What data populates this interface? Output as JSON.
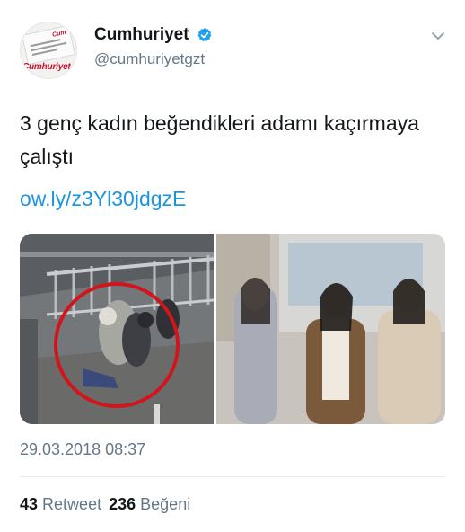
{
  "account": {
    "name": "Cumhuriyet",
    "handle": "@cumhuriyetgzt",
    "avatar_logo_text": "Cumhuriyet",
    "verified": true
  },
  "tweet": {
    "text": "3 genç kadın beğendikleri adamı kaçırmaya çalıştı",
    "link": "ow.ly/z3Yl30jdgzE",
    "timestamp": "29.03.2018 08:37"
  },
  "stats": {
    "retweets_count": "43",
    "retweets_label": "Retweet",
    "likes_count": "236",
    "likes_label": "Beğeni"
  },
  "icons": {
    "verified": "verified-badge-icon",
    "menu": "chevron-down-icon"
  },
  "colors": {
    "text": "#14171a",
    "secondary": "#657786",
    "link": "#1b95e0",
    "verified": "#1da1f2",
    "highlight_circle": "#d0151d"
  }
}
